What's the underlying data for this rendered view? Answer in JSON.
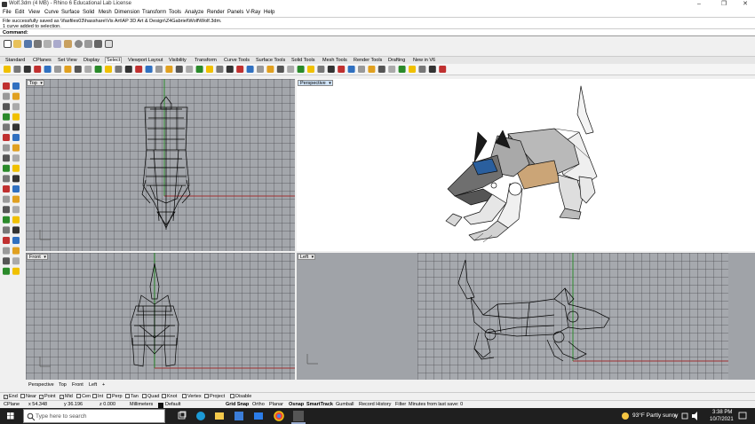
{
  "window": {
    "title": "Wolf.3dm (4 MB) - Rhino 6 Educational Lab License",
    "controls": [
      "–",
      "❐",
      "✕"
    ]
  },
  "menu": [
    "File",
    "Edit",
    "View",
    "Curve",
    "Surface",
    "Solid",
    "Mesh",
    "Dimension",
    "Transform",
    "Tools",
    "Analyze",
    "Render",
    "Panels",
    "V-Ray",
    "Help"
  ],
  "command_history": [
    "File successfully saved as \\\\fasfiles03\\hasshare\\Vis Art\\AP 3D Art & Design\\Z4Gabriel\\Wolf\\Wolf.3dm.",
    "1 curve added to selection."
  ],
  "command_prompt": "Command:",
  "toolbar_tabs": [
    "Standard",
    "CPlanes",
    "Set View",
    "Display",
    "Select",
    "Viewport Layout",
    "Visibility",
    "Transform",
    "Curve Tools",
    "Surface Tools",
    "Solid Tools",
    "Mesh Tools",
    "Render Tools",
    "Drafting",
    "New in V6"
  ],
  "active_toolbar_tab": "Select",
  "viewports": {
    "top": "Top",
    "perspective": "Perspective",
    "front": "Front",
    "left": "Left"
  },
  "viewport_tabs": [
    "Perspective",
    "Top",
    "Front",
    "Left",
    "+"
  ],
  "osnaps": [
    {
      "label": "End",
      "checked": true
    },
    {
      "label": "Near",
      "checked": false
    },
    {
      "label": "Point",
      "checked": true
    },
    {
      "label": "Mid",
      "checked": true
    },
    {
      "label": "Cen",
      "checked": false
    },
    {
      "label": "Int",
      "checked": false
    },
    {
      "label": "Perp",
      "checked": false
    },
    {
      "label": "Tan",
      "checked": false
    },
    {
      "label": "Quad",
      "checked": false
    },
    {
      "label": "Knot",
      "checked": false
    },
    {
      "label": "Vertex",
      "checked": false
    },
    {
      "label": "Project",
      "checked": false
    },
    {
      "label": "Disable",
      "checked": false
    }
  ],
  "status": {
    "cplane": "CPlane",
    "x": "x 54.348",
    "y": "y 36.196",
    "z": "z 0.000",
    "units": "Millimeters",
    "layer": "Default",
    "toggles": [
      "Grid Snap",
      "Ortho",
      "Planar",
      "Osnap",
      "SmartTrack",
      "Gumball",
      "Record History",
      "Filter"
    ],
    "message": "Minutes from last save: 0"
  },
  "taskbar": {
    "search_placeholder": "Type here to search",
    "weather": "93°F  Partly sunny",
    "time": "3:38 PM",
    "date": "10/7/2021"
  }
}
